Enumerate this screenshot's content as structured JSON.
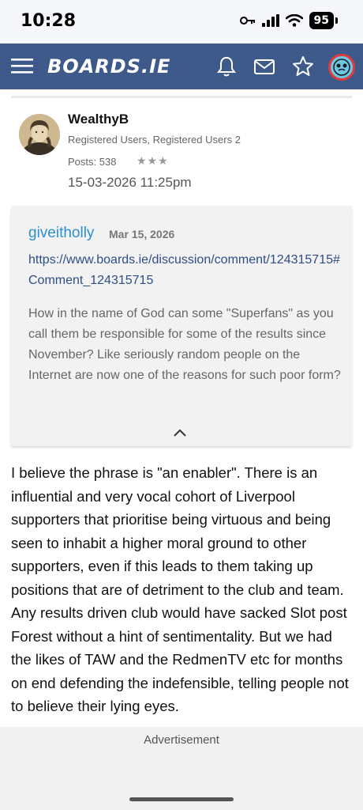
{
  "status_bar": {
    "time": "10:28",
    "battery": "95",
    "icons": [
      "key-icon",
      "signal-icon",
      "wifi-icon",
      "battery-icon"
    ]
  },
  "header": {
    "logo": "BOARDS.IE",
    "icons": [
      "menu-icon",
      "bell-icon",
      "mail-icon",
      "star-icon",
      "user-avatar"
    ],
    "colors": {
      "bar": "#3d5a8a",
      "avatar_ring": "#e03a3a"
    }
  },
  "post": {
    "author": "WealthyB",
    "roles": "Registered Users, Registered Users 2",
    "posts": "Posts: 538",
    "rank": "★★★",
    "date": "15-03-2026 11:25pm",
    "quote": {
      "user": "giveitholly",
      "date": "Mar 15, 2026",
      "link": "https://www.boards.ie/discussion/comment/124315715#Comment_124315715",
      "text": "How in the name of God can some \"Superfans\" as you call them be responsible for some of the results since November? Like seriously random people on the Internet are now one of the reasons for such poor form?"
    },
    "body": "I believe the phrase is \"an enabler\". There is an influential and very vocal cohort of Liverpool supporters that prioritise being virtuous and being seen to inhabit a higher moral ground to other supporters, even if this leads to them taking up positions that are of detriment to the club and team. Any results driven club would have sacked Slot post Forest without a hint of sentimentality. But we had the likes of TAW and the RedmenTV etc for months on end defending the indefensible, telling people not to believe their lying eyes."
  },
  "ad": {
    "label": "Advertisement"
  }
}
